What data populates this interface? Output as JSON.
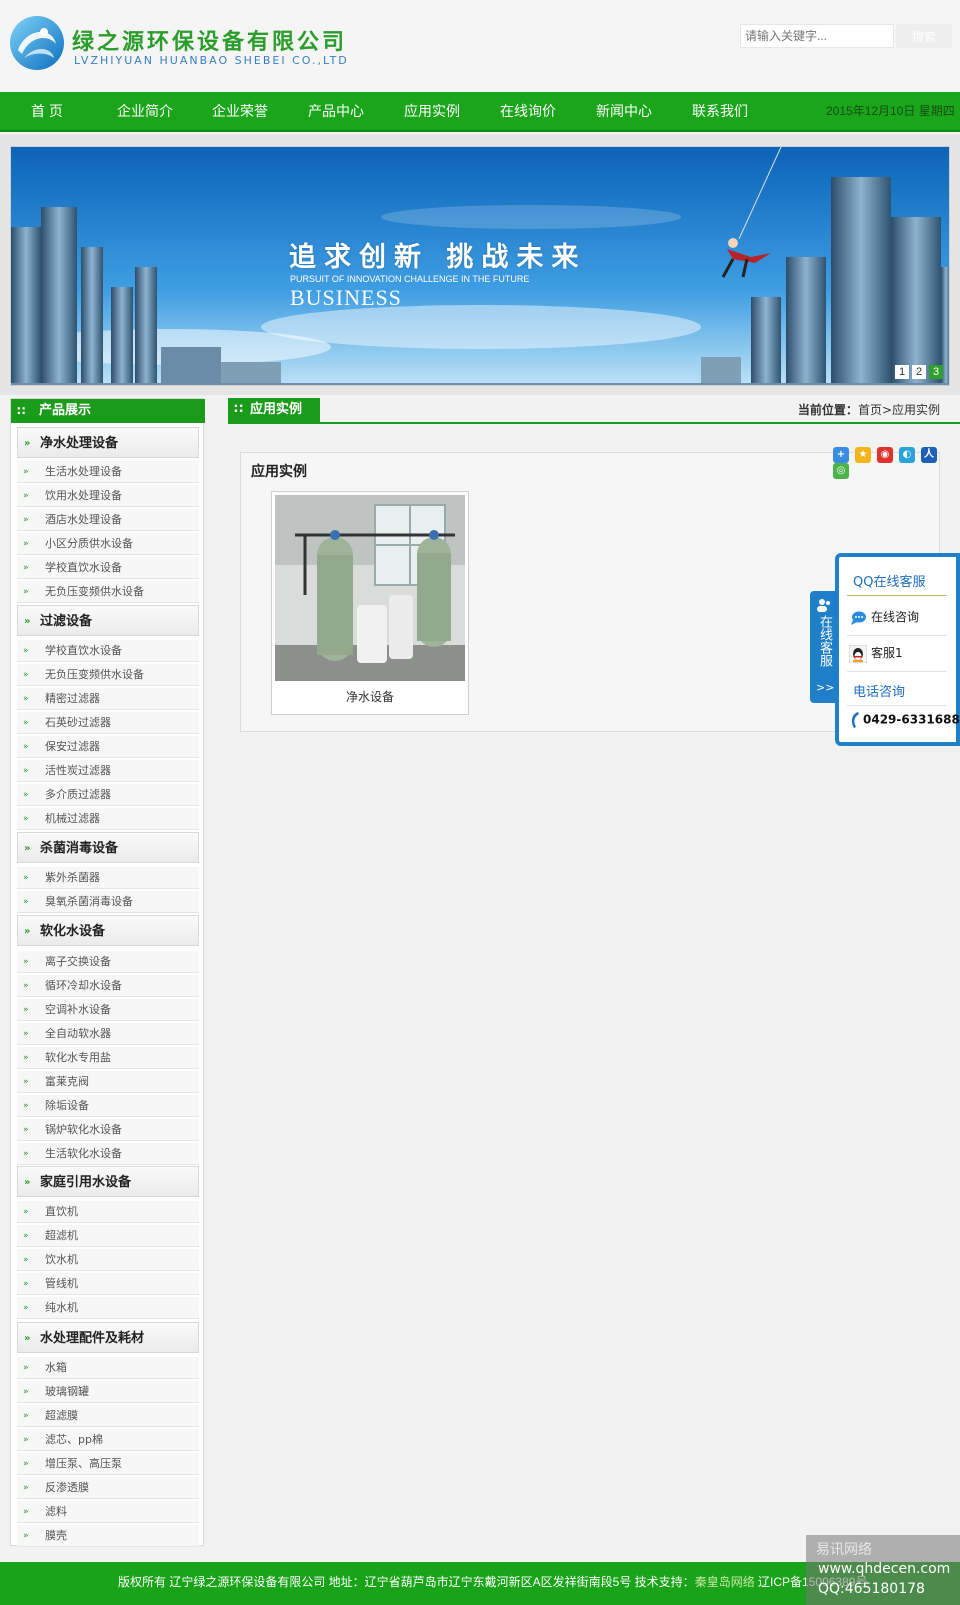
{
  "header": {
    "logo_cn": "绿之源环保设备有限公司",
    "logo_en": "LVZHIYUAN HUANBAO SHEBEI CO.,LTD",
    "search_placeholder": "请输入关键字...",
    "search_button": "搜索"
  },
  "nav": {
    "items": [
      {
        "label": "首 页"
      },
      {
        "label": "企业简介"
      },
      {
        "label": "企业荣誉"
      },
      {
        "label": "产品中心"
      },
      {
        "label": "应用实例"
      },
      {
        "label": "在线询价"
      },
      {
        "label": "新闻中心"
      },
      {
        "label": "联系我们"
      }
    ],
    "date": "2015年12月10日 星期四"
  },
  "banner": {
    "slogan": "追求创新 挑战未来",
    "sub": "PURSUIT OF INNOVATION CHALLENGE IN THE FUTURE",
    "big": "BUSINESS",
    "dots": [
      "1",
      "2",
      "3"
    ]
  },
  "sidebar": {
    "title": "产品展示",
    "categories": [
      {
        "label": "净水处理设备",
        "items": [
          "生活水处理设备",
          "饮用水处理设备",
          "酒店水处理设备",
          "小区分质供水设备",
          "学校直饮水设备",
          "无负压变频供水设备"
        ]
      },
      {
        "label": "过滤设备",
        "items": [
          "学校直饮水设备",
          "无负压变频供水设备",
          "精密过滤器",
          "石英砂过滤器",
          "保安过滤器",
          "活性炭过滤器",
          "多介质过滤器",
          "机械过滤器"
        ]
      },
      {
        "label": "杀菌消毒设备",
        "items": [
          "紫外杀菌器",
          "臭氧杀菌消毒设备"
        ]
      },
      {
        "label": "软化水设备",
        "items": [
          "离子交换设备",
          "循环冷却水设备",
          "空调补水设备",
          "全自动软水器",
          "软化水专用盐",
          "富莱克阀",
          "除垢设备",
          "锅炉软化水设备",
          "生活软化水设备"
        ]
      },
      {
        "label": "家庭引用水设备",
        "items": [
          "直饮机",
          "超滤机",
          "饮水机",
          "管线机",
          "纯水机"
        ]
      },
      {
        "label": "水处理配件及耗材",
        "items": [
          "水箱",
          "玻璃钢罐",
          "超滤膜",
          "滤芯、pp棉",
          "增压泵、高压泵",
          "反渗透膜",
          "滤料",
          "膜壳"
        ]
      }
    ]
  },
  "main": {
    "tab": "应用实例",
    "crumb_label": "当前位置：",
    "crumb_path": "首页>应用实例",
    "content_title": "应用实例",
    "card_caption": "净水设备",
    "share_icons": [
      "share-plus-icon",
      "qzone-icon",
      "weibo-icon",
      "tqq-icon",
      "renren-icon",
      "wechat-icon"
    ]
  },
  "service": {
    "tab_text": "在线客服",
    "tab_arrows": ">>",
    "title": "QQ在线客服",
    "consult": "在线咨询",
    "agent": "客服1",
    "phone_title": "电话咨询",
    "phone": "0429-6331688"
  },
  "footer": {
    "text_prefix": "版权所有 辽宁绿之源环保设备有限公司 地址：辽宁省葫芦岛市辽宁东戴河新区A区发祥街南段5号 技术支持：",
    "tech_link": "秦皇岛网络",
    "icp": "辽ICP备15006389号"
  },
  "watermark": {
    "line1": "易讯网络",
    "line2": "www.qhdecen.com",
    "line3": "QQ:465180178"
  },
  "colors": {
    "brand_green": "#1aa51a",
    "service_blue": "#1f7fc9"
  }
}
